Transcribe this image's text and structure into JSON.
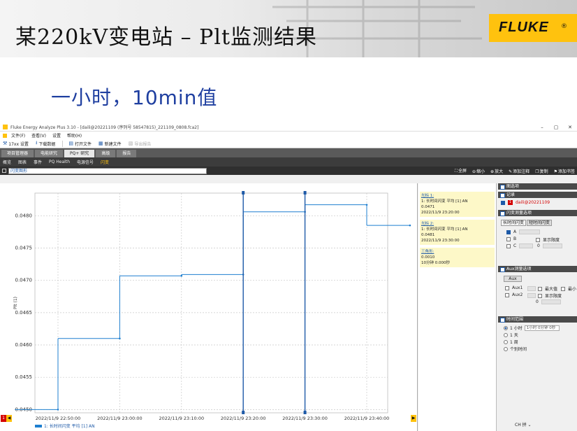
{
  "slide": {
    "title": "某220kV变电站 – Plt监测结果",
    "subtitle": "一小时，10min值",
    "brand": "FLUKE",
    "brand_mark": "®"
  },
  "window": {
    "title": "Fluke Energy Analyze Plus 3.10 - [daili@20221109 (序列号 58547815)_221109_0808.fca2]",
    "min": "–",
    "max": "▢",
    "close": "✕"
  },
  "menu": [
    "文件(F)",
    "查看(V)",
    "设置",
    "帮助(H)"
  ],
  "toolbar": {
    "settings": "17xx 设置",
    "download": "下载数据",
    "open": "打开文件",
    "new": "新建文件",
    "export": "导出报告"
  },
  "main_tabs": [
    "项目管理器",
    "电能研究",
    "PQ+ 研究",
    "高级",
    "报告"
  ],
  "sub_tabs": [
    "概览",
    "图表",
    "事件",
    "PQ Health",
    "电源信号",
    "闪变"
  ],
  "chart_toolbar": {
    "selector": "闪变图形",
    "actions": [
      "全屏",
      "缩小",
      "放大",
      "添加注释",
      "复制",
      "添加书签"
    ]
  },
  "chart_data": {
    "type": "line",
    "x": [
      "2022/11/9 22:50",
      "2022/11/9 23:00",
      "2022/11/9 23:10",
      "2022/11/9 23:20",
      "2022/11/9 23:30",
      "2022/11/9 23:40"
    ],
    "series": [
      {
        "name": "1: 长时间闪变 平均 [1] AN",
        "values": [
          0.045,
          0.0461,
          0.04707,
          0.04709,
          0.04806,
          0.04817,
          0.04785
        ]
      }
    ],
    "x_tick_labels": [
      "2022/11/9 22:50:00",
      "2022/11/9 23:00:00",
      "2022/11/9 23:10:00",
      "2022/11/9 23:20:00",
      "2022/11/9 23:30:00",
      "2022/11/9 23:40:00"
    ],
    "y_tick_labels": [
      "0.0450",
      "0.0455",
      "0.0460",
      "0.0465",
      "0.0470",
      "0.0475",
      "0.0480"
    ],
    "ylabel": "Plt (1)",
    "ylim": [
      0.04495,
      0.04835
    ],
    "grid": true,
    "cursors": [
      "2022/11/9 23:20:00",
      "2022/11/9 23:30:00"
    ]
  },
  "cursor_info": {
    "c1_title": "光标 1:",
    "c1_series": "1: 长时间闪变 平均 [1] AN",
    "c1_value": "0.0471",
    "c1_time": "2022/11/9 23:20:00",
    "c2_title": "光标 2:",
    "c2_series": "1: 长时间闪变 平均 [1] AN",
    "c2_value": "0.0481",
    "c2_time": "2022/11/9 23:30:00",
    "delta_title": "三角形:",
    "delta_value": "0.0010",
    "delta_time": "10分钟 0.000秒"
  },
  "side": {
    "select_title": "图选项",
    "record_title": "记录",
    "record_item": "daili@20221109",
    "flicker_title": "闪变测量选项",
    "tab_long": "长时间闪变",
    "tab_short": "短时间闪变",
    "phases": [
      "A",
      "B",
      "C"
    ],
    "show_limit": "显示限度",
    "limit_zero": "0",
    "aux_title": "Aux测量选项",
    "aux_btn": "Aux",
    "aux1": "Aux1",
    "aux2": "Aux2",
    "max_label": "最大值",
    "min_label": "最小",
    "aux_show_limit": "显示限度",
    "aux_zero": "0",
    "time_title": "时间范围",
    "time_opts": [
      "1 小时",
      "1 天",
      "1 周",
      "个别时间"
    ],
    "time_select": "1小时 0分钟 0秒",
    "corner": "CH 拼 ⌄"
  },
  "colors": {
    "series": "#1e7fd0",
    "accent": "#ffc20e",
    "title_blue": "#1f3fa0"
  }
}
